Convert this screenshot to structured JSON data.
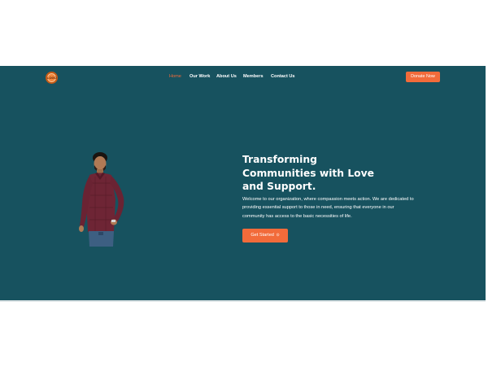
{
  "navbar": {
    "logo_text": "LOGO",
    "links": [
      {
        "label": "Home",
        "active": true
      },
      {
        "label": "Our Work",
        "active": false
      },
      {
        "label": "About Us",
        "active": false
      },
      {
        "label": "Members",
        "active": false
      },
      {
        "label": "Contact Us",
        "active": false
      }
    ],
    "donate_label": "Donate Now"
  },
  "hero": {
    "headline_line1": "Transforming",
    "headline_line2": "Communities with Love",
    "headline_line3": "and Support.",
    "description": "Welcome to our organization, where compassion meets action. We are dedicated to providing essential support to those in need, ensuring that everyone in our community has access to the basic necessities of life.",
    "cta_label": "Get Started",
    "cta_icon": "arrow-circle-icon"
  },
  "colors": {
    "hero_bg": "#17525f",
    "accent": "#f26b3a",
    "text": "#ffffff"
  }
}
